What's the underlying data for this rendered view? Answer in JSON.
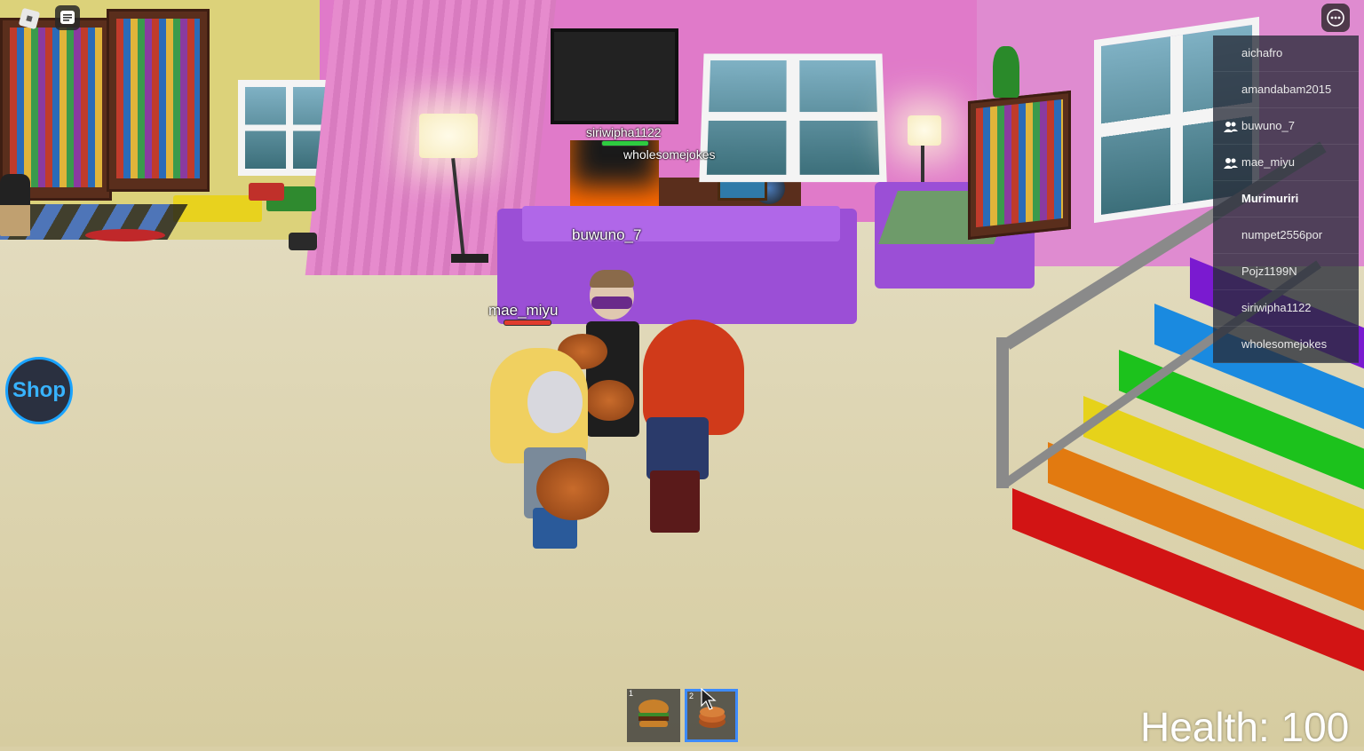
{
  "hud": {
    "shop_label": "Shop",
    "health_text": "Health: 100"
  },
  "player_list": [
    {
      "name": "aichafro",
      "friend": false,
      "local": false
    },
    {
      "name": "amandabam2015",
      "friend": false,
      "local": false
    },
    {
      "name": "buwuno_7",
      "friend": true,
      "local": false
    },
    {
      "name": "mae_miyu",
      "friend": true,
      "local": false
    },
    {
      "name": "Murimuriri",
      "friend": false,
      "local": true
    },
    {
      "name": "numpet2556por",
      "friend": false,
      "local": false
    },
    {
      "name": "Pojz1199N",
      "friend": false,
      "local": false
    },
    {
      "name": "siriwipha1122",
      "friend": false,
      "local": false
    },
    {
      "name": "wholesomejokes",
      "friend": false,
      "local": false
    }
  ],
  "nametags": {
    "siriwipha": "siriwipha1122",
    "wholesome": "wholesomejokes",
    "buwuno": "buwuno_7",
    "mae": "mae_miyu"
  },
  "hotbar": [
    {
      "slot": "1",
      "item_icon": "burger-icon",
      "selected": false
    },
    {
      "slot": "2",
      "item_icon": "pancake-icon",
      "selected": true
    }
  ],
  "colors": {
    "accent": "#1aa3ff",
    "health_full": "#2ecc40",
    "health_low": "#e03c2e"
  }
}
